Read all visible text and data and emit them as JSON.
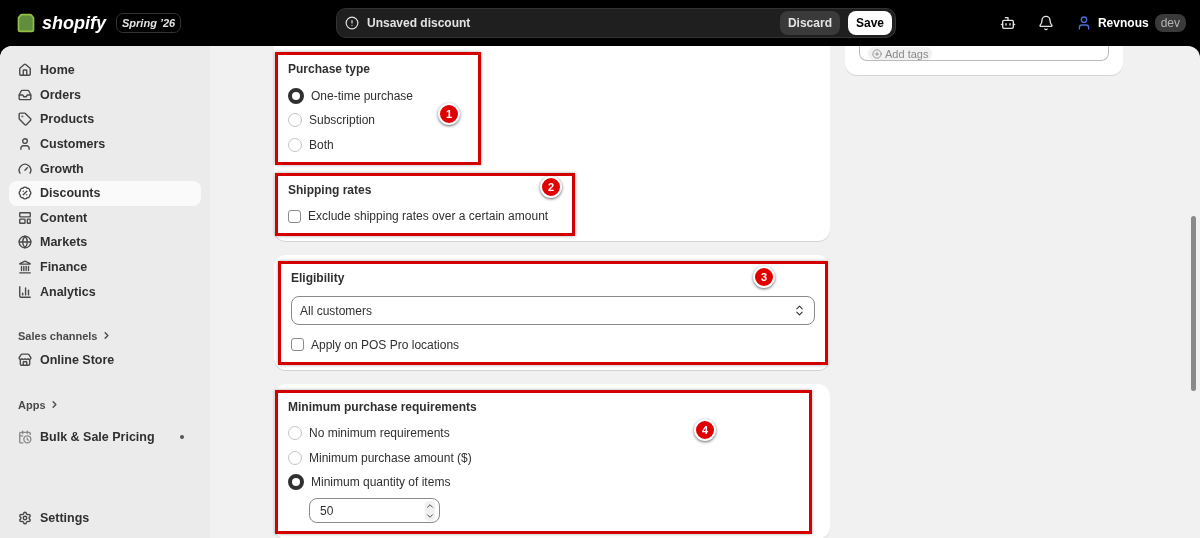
{
  "topbar": {
    "brand": "shopify",
    "edition": "Spring ’26",
    "notice": "Unsaved discount",
    "discard": "Discard",
    "save": "Save",
    "user": "Revnous",
    "env": "dev"
  },
  "sidebar": {
    "items": [
      {
        "kind": "nav",
        "label": "Home",
        "selected": false
      },
      {
        "kind": "nav",
        "label": "Orders",
        "selected": false
      },
      {
        "kind": "nav",
        "label": "Products",
        "selected": false
      },
      {
        "kind": "nav",
        "label": "Customers",
        "selected": false
      },
      {
        "kind": "nav",
        "label": "Growth",
        "selected": false
      },
      {
        "kind": "nav",
        "label": "Discounts",
        "selected": true
      },
      {
        "kind": "nav",
        "label": "Content",
        "selected": false
      },
      {
        "kind": "nav",
        "label": "Markets",
        "selected": false
      },
      {
        "kind": "nav",
        "label": "Finance",
        "selected": false
      },
      {
        "kind": "nav",
        "label": "Analytics",
        "selected": false
      },
      {
        "kind": "heading",
        "label": "Sales channels"
      },
      {
        "kind": "nav",
        "label": "Online Store",
        "selected": false
      },
      {
        "kind": "heading",
        "label": "Apps"
      },
      {
        "kind": "app",
        "label": "Bulk & Sale Pricing",
        "selected": false
      }
    ],
    "settings": "Settings"
  },
  "tags": {
    "label": "Add tags"
  },
  "purchase_type": {
    "title": "Purchase type",
    "callout": "1",
    "options": [
      {
        "label": "One-time purchase",
        "selected": true
      },
      {
        "label": "Subscription",
        "selected": false
      },
      {
        "label": "Both",
        "selected": false
      }
    ]
  },
  "shipping_rates": {
    "title": "Shipping rates",
    "callout": "2",
    "checkbox": {
      "label": "Exclude shipping rates over a certain amount",
      "checked": false
    }
  },
  "eligibility": {
    "title": "Eligibility",
    "callout": "3",
    "select": "All customers",
    "checkbox": {
      "label": "Apply on POS Pro locations",
      "checked": false
    }
  },
  "minimum": {
    "title": "Minimum purchase requirements",
    "callout": "4",
    "options": [
      {
        "label": "No minimum requirements",
        "selected": false
      },
      {
        "label": "Minimum purchase amount ($)",
        "selected": false
      },
      {
        "label": "Minimum quantity of items",
        "selected": true
      }
    ],
    "quantity": "50"
  }
}
